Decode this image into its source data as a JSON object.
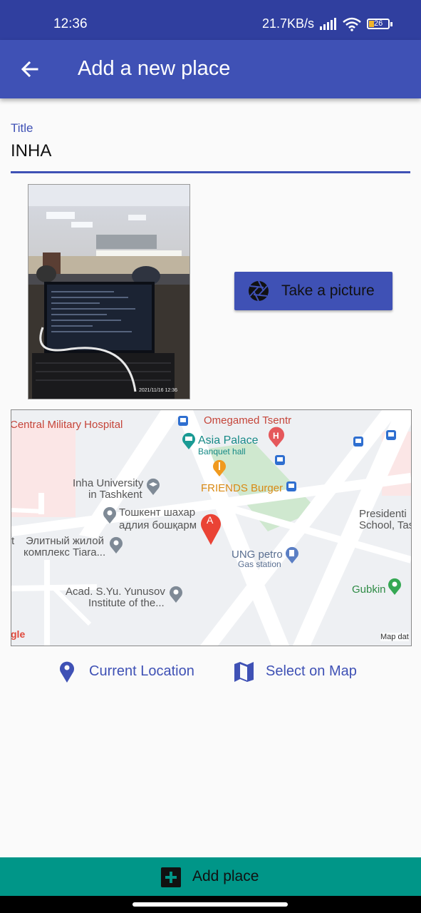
{
  "status_bar": {
    "time": "12:36",
    "net_speed": "21.7KB/s",
    "battery": "26"
  },
  "app_bar": {
    "title": "Add a new place",
    "back_icon": "arrow-left-icon"
  },
  "form": {
    "title_label": "Title",
    "title_value": "INHA"
  },
  "photo": {
    "timestamp": "2021/11/16 12:36"
  },
  "take_picture": {
    "label": "Take a picture",
    "icon": "camera-shutter-icon"
  },
  "map": {
    "labels": {
      "hospital": "Central Military Hospital",
      "omegamed": "Omegamed Tsentr",
      "asia_palace": "Asia Palace",
      "banquet": "Banquet hall",
      "inha1": "Inha University",
      "inha2": "in Tashkent",
      "friends": "FRIENDS Burger",
      "toshkent1": "Тошкент шахар",
      "toshkent2": "адлия бошқарм",
      "elit1": "Элитный жилой",
      "elit2": "комплекс Tiara...",
      "ung": "UNG petro",
      "gas": "Gas station",
      "pres1": "Presidenti",
      "pres2": "School, Taske",
      "gubkin": "Gubkin",
      "acad1": "Acad. S.Yu. Yunusov",
      "acad2": "Institute of the...",
      "google": "gle",
      "mapdata": "Map dat",
      "marker": "A",
      "left_cut": "t"
    },
    "marker_color": "#ea4335"
  },
  "actions": {
    "current_location": "Current Location",
    "select_on_map": "Select on Map"
  },
  "add_place": {
    "label": "Add place",
    "icon": "add-box-icon"
  },
  "colors": {
    "primary": "#3f51b5",
    "primary_dark": "#303f9f",
    "accent": "#009688"
  }
}
